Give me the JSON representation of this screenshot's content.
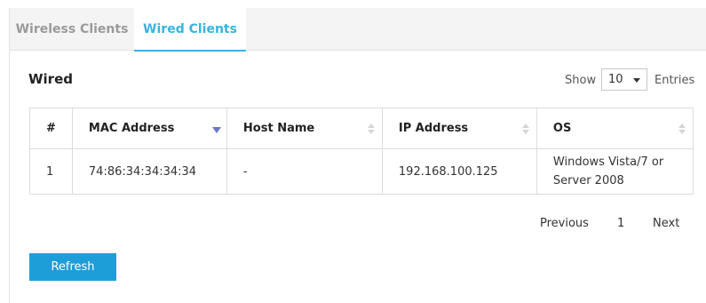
{
  "tabs": {
    "wireless_label": "Wireless Clients",
    "wired_label": "Wired Clients",
    "active": "Wired Clients",
    "active_color": "#37b3e0"
  },
  "section": {
    "title": "Wired"
  },
  "entries": {
    "show_label": "Show",
    "selected": "10",
    "entries_label": "Entries"
  },
  "table": {
    "headers": {
      "num": "#",
      "mac": "MAC Address",
      "host": "Host Name",
      "ip": "IP Address",
      "os": "OS"
    },
    "sort_column": "MAC Address",
    "rows": [
      {
        "num": "1",
        "mac": "74:86:34:34:34:34",
        "host": "-",
        "ip": "192.168.100.125",
        "os": "Windows Vista/7 or Server 2008"
      }
    ]
  },
  "pagination": {
    "previous": "Previous",
    "page": "1",
    "next": "Next"
  },
  "actions": {
    "refresh_label": "Refresh",
    "refresh_color": "#1e9ed8"
  }
}
